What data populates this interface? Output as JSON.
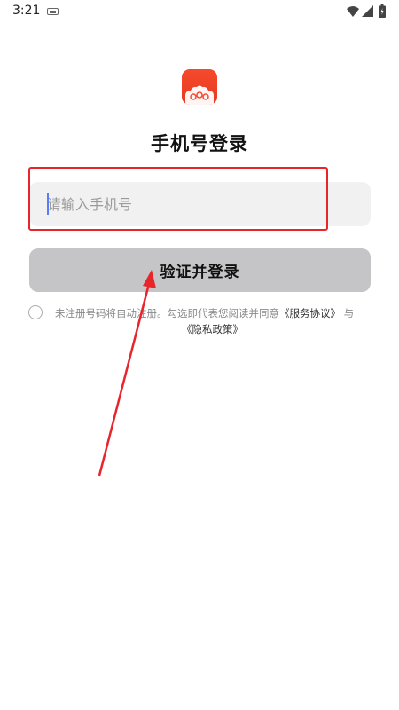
{
  "status_bar": {
    "time": "3:21"
  },
  "title": "手机号登录",
  "phone_input": {
    "placeholder": "请输入手机号",
    "value": ""
  },
  "login_button": {
    "label": "验证并登录"
  },
  "agreement": {
    "prefix": "未注册号码将自动注册。勾选即代表您阅读并同意",
    "service_link": "《服务协议》",
    "conjunction": "与",
    "privacy_link": "《隐私政策》"
  },
  "colors": {
    "logo": "#f54a2d",
    "button_bg": "#c5c5c7",
    "input_bg": "#f1f1f1",
    "annotation_red": "#e8252b"
  },
  "icons": {
    "status": [
      "keyboard-icon",
      "wifi-icon",
      "signal-icon",
      "battery-icon"
    ],
    "logo": "cloud-swirl-logo-icon"
  }
}
